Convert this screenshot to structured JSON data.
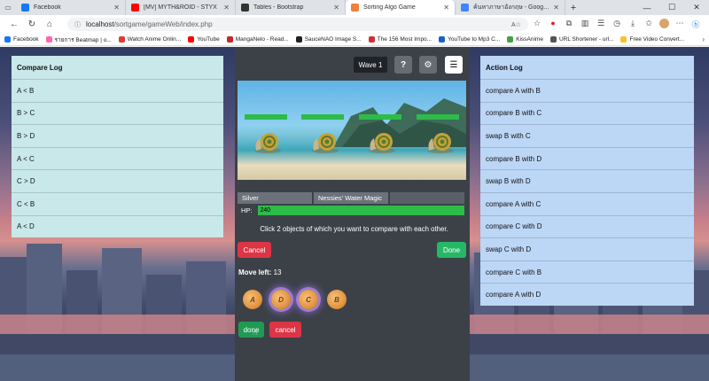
{
  "browser": {
    "tabs": [
      {
        "label": "Facebook",
        "color": "#1877f2",
        "active": false
      },
      {
        "label": "[MV] MYTH&ROID - STYX",
        "color": "#ff0000",
        "active": false
      },
      {
        "label": "Tables - Bootstrap",
        "color": "#333333",
        "active": false
      },
      {
        "label": "Sorting Algo Game",
        "color": "#f0803c",
        "active": true
      },
      {
        "label": "ค้นหาภาษาอังกฤษ - Google Search",
        "color": "#4285f4",
        "active": false
      }
    ],
    "url_host": "localhost",
    "url_path": "/sortgame/gameWeb/index.php",
    "bookmarks": [
      {
        "label": "Facebook",
        "color": "#1877f2"
      },
      {
        "label": "รายการ Beatmap | o...",
        "color": "#ff66aa"
      },
      {
        "label": "Watch Anime Onlin...",
        "color": "#e53935"
      },
      {
        "label": "YouTube",
        "color": "#ff0000"
      },
      {
        "label": "MangaNelo - Read...",
        "color": "#c62828"
      },
      {
        "label": "SauceNAO Image S...",
        "color": "#222222"
      },
      {
        "label": "The 156 Most Impo...",
        "color": "#d32f2f"
      },
      {
        "label": "YouTube to Mp3 C...",
        "color": "#1565c0"
      },
      {
        "label": "KissAnime",
        "color": "#43a047"
      },
      {
        "label": "URL Shortener - url...",
        "color": "#555555"
      },
      {
        "label": "Free Video Convert...",
        "color": "#fbc02d"
      }
    ]
  },
  "compare_log": {
    "title": "Compare Log",
    "items": [
      "A < B",
      "B > C",
      "B > D",
      "A < C",
      "C > D",
      "C < B",
      "A < D"
    ]
  },
  "action_log": {
    "title": "Action Log",
    "items": [
      "compare A with B",
      "compare B with C",
      "swap B with C",
      "compare B with D",
      "swap B with D",
      "compare A with C",
      "compare C with D",
      "swap C with D",
      "compare C with B",
      "compare A with D"
    ]
  },
  "game": {
    "wave_label": "Wave 1",
    "help_glyph": "?",
    "enemy_name": "Silver",
    "enemy_skill": "Nessies' Water Magic",
    "hp_label": "HP:",
    "hp_value": "240",
    "instruction": "Click 2 objects of which you want to compare with each other.",
    "cancel_label": "Cancel",
    "done_label": "Done",
    "moves_label": "Move left:",
    "moves_value": "13",
    "coins": [
      {
        "letter": "A",
        "selected": false
      },
      {
        "letter": "D",
        "selected": true
      },
      {
        "letter": "C",
        "selected": true
      },
      {
        "letter": "B",
        "selected": false
      }
    ],
    "done2_label": "done",
    "cancel2_label": "cancel"
  }
}
